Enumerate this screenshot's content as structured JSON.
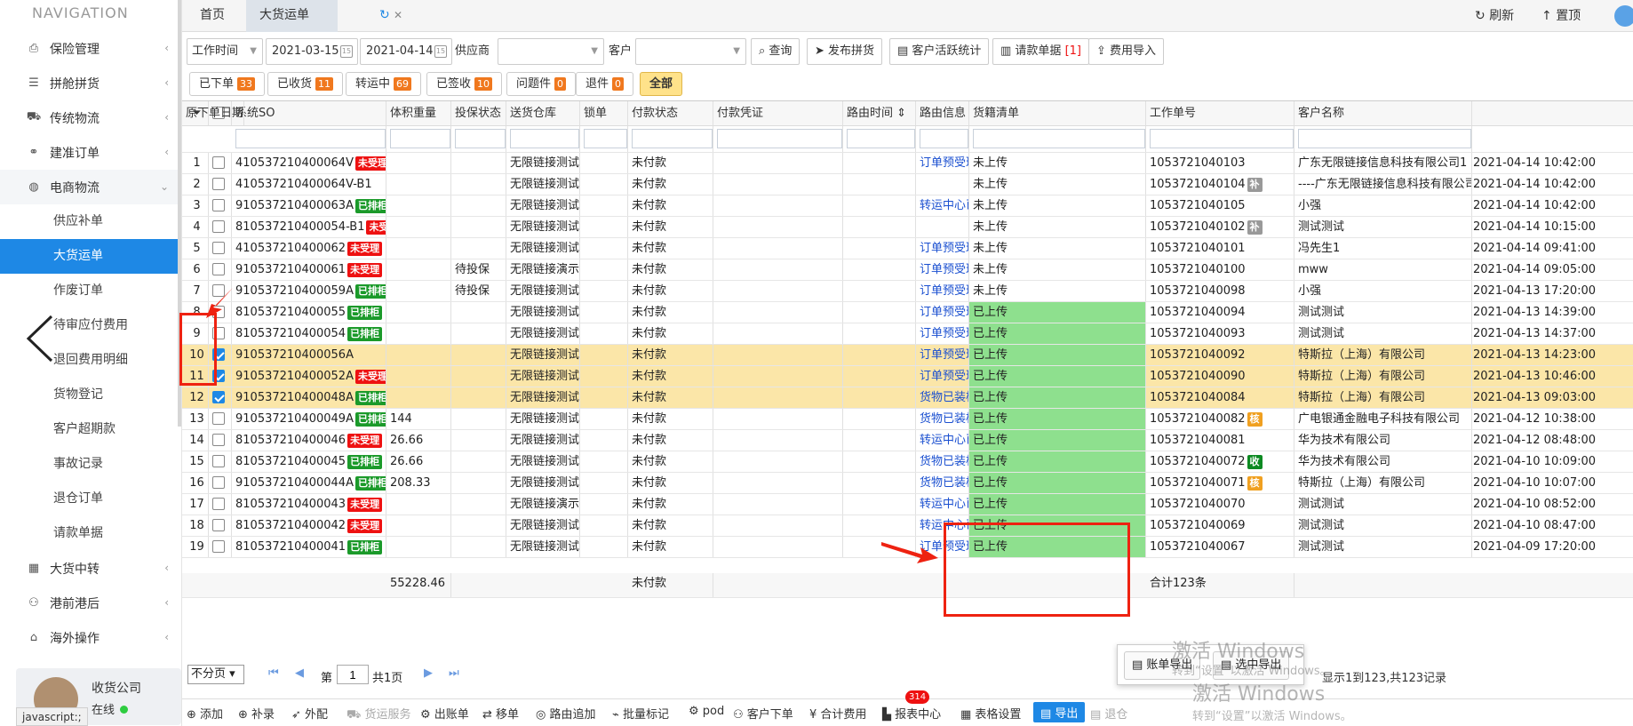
{
  "sidebar": {
    "title": "NAVIGATION",
    "items": [
      {
        "label": "保险管理",
        "icon": "shield-doc-icon"
      },
      {
        "label": "拼舱拼货",
        "icon": "list-icon"
      },
      {
        "label": "传统物流",
        "icon": "truck-icon"
      },
      {
        "label": "建准订单",
        "icon": "link-icon"
      }
    ],
    "open_group": {
      "label": "电商物流",
      "icon": "globe-icon"
    },
    "sub_items": [
      "供应补单",
      "大货运单",
      "作废订单",
      "待审应付费用",
      "退回费用明细",
      "货物登记",
      "客户超期款",
      "事故记录",
      "退仓订单",
      "请款单据"
    ],
    "active_sub": "大货运单",
    "more_items": [
      {
        "label": "大货中转",
        "icon": "grid-icon"
      },
      {
        "label": "港前港后",
        "icon": "people-icon"
      },
      {
        "label": "海外操作",
        "icon": "building-icon"
      }
    ],
    "user": {
      "name": "收货公司",
      "status": "在线"
    },
    "status_url": "javascript:;"
  },
  "tabs": {
    "home": "首页",
    "current": "大货运单"
  },
  "top_actions": {
    "refresh": "刷新",
    "top": "置顶"
  },
  "toolbar": {
    "time_type": "工作时间",
    "date_from": "2021-03-15",
    "date_to": "2021-04-14",
    "supplier_label": "供应商",
    "customer_label": "客户",
    "query": "查询",
    "publish": "发布拼货",
    "stats": "客户活跃统计",
    "payment": "请款单据",
    "payment_count": "[1]",
    "fee_import": "费用导入"
  },
  "filters": [
    {
      "label": "已下单",
      "count": "33"
    },
    {
      "label": "已收货",
      "count": "11"
    },
    {
      "label": "转运中",
      "count": "69"
    },
    {
      "label": "已签收",
      "count": "10"
    },
    {
      "label": "问题件",
      "count": "0"
    },
    {
      "label": "退件",
      "count": "0"
    },
    {
      "label": "全部",
      "count": ""
    }
  ],
  "columns": [
    "系统SO",
    "体积重量",
    "投保状态",
    "送货仓库",
    "锁单",
    "付款状态",
    "付款凭证",
    "路由时间 ⇕",
    "路由信息",
    "货籍清单",
    "工作单号",
    "客户名称",
    "原下单日期"
  ],
  "rows": [
    {
      "no": "1",
      "so": "410537210400064V",
      "tag": "未受理",
      "tagc": "red",
      "vol": "",
      "ins": "",
      "wh": "无限链接测试仓库",
      "pay": "未付款",
      "route": "订单预受理",
      "upl": "未上传",
      "upl_green": false,
      "job": "1053721040103",
      "jt": "",
      "jtc": "",
      "cust": "广东无限链接信息科技有限公司1",
      "date": "2021-04-14 10:42:00",
      "checked": false
    },
    {
      "no": "2",
      "so": "410537210400064V-B1",
      "tag": "",
      "tagc": "",
      "vol": "",
      "ins": "",
      "wh": "无限链接测试仓库",
      "pay": "未付款",
      "route": "",
      "upl": "未上传",
      "upl_green": false,
      "job": "1053721040104",
      "jt": "补",
      "jtc": "gray",
      "cust": "----广东无限链接信息科技有限公司",
      "date": "2021-04-14 10:42:00",
      "checked": false
    },
    {
      "no": "3",
      "so": "910537210400063A",
      "tag": "已排柜",
      "tagc": "green",
      "vol": "",
      "ins": "",
      "wh": "无限链接测试仓库",
      "pay": "未付款",
      "route": "转运中心已收货",
      "upl": "未上传",
      "upl_green": false,
      "job": "1053721040105",
      "jt": "",
      "jtc": "",
      "cust": "小强",
      "date": "2021-04-14 10:42:00",
      "checked": false
    },
    {
      "no": "4",
      "so": "810537210400054-B1",
      "tag": "未受",
      "tagc": "red",
      "vol": "",
      "ins": "",
      "wh": "无限链接测试仓库",
      "pay": "未付款",
      "route": "",
      "upl": "未上传",
      "upl_green": false,
      "job": "1053721040102",
      "jt": "补",
      "jtc": "gray",
      "cust": "测试测试",
      "date": "2021-04-14 10:15:00",
      "checked": false
    },
    {
      "no": "5",
      "so": "410537210400062",
      "tag": "未受理",
      "tagc": "red",
      "vol": "",
      "ins": "",
      "wh": "无限链接测试仓库",
      "pay": "未付款",
      "route": "订单预受理",
      "upl": "未上传",
      "upl_green": false,
      "job": "1053721040101",
      "jt": "",
      "jtc": "",
      "cust": "冯先生1",
      "date": "2021-04-14 09:41:00",
      "checked": false
    },
    {
      "no": "6",
      "so": "910537210400061",
      "tag": "未受理",
      "tagc": "red",
      "vol": "",
      "ins": "待投保",
      "wh": "无限链接演示仓库",
      "pay": "未付款",
      "route": "订单预受理",
      "upl": "未上传",
      "upl_green": false,
      "job": "1053721040100",
      "jt": "",
      "jtc": "",
      "cust": "mww",
      "date": "2021-04-14 09:05:00",
      "checked": false
    },
    {
      "no": "7",
      "so": "910537210400059A",
      "tag": "已排柜",
      "tagc": "green",
      "vol": "",
      "ins": "待投保",
      "wh": "无限链接测试仓库",
      "pay": "未付款",
      "route": "订单预受理Ne",
      "upl": "未上传",
      "upl_green": false,
      "job": "1053721040098",
      "jt": "",
      "jtc": "",
      "cust": "小强",
      "date": "2021-04-13 17:20:00",
      "checked": false
    },
    {
      "no": "8",
      "so": "810537210400055",
      "tag": "已排柜",
      "tagc": "green",
      "vol": "",
      "ins": "",
      "wh": "无限链接测试仓库",
      "pay": "未付款",
      "route": "订单预受理 SC",
      "upl": "已上传",
      "upl_green": true,
      "job": "1053721040094",
      "jt": "",
      "jtc": "",
      "cust": "测试测试",
      "date": "2021-04-13 14:39:00",
      "checked": false
    },
    {
      "no": "9",
      "so": "810537210400054",
      "tag": "已排柜",
      "tagc": "green",
      "vol": "",
      "ins": "",
      "wh": "无限链接测试仓库",
      "pay": "未付款",
      "route": "订单预受理 SC",
      "upl": "已上传",
      "upl_green": true,
      "job": "1053721040093",
      "jt": "",
      "jtc": "",
      "cust": "测试测试",
      "date": "2021-04-13 14:37:00",
      "checked": false
    },
    {
      "no": "10",
      "so": "910537210400056A",
      "tag": "",
      "tagc": "",
      "vol": "",
      "ins": "",
      "wh": "无限链接测试仓库",
      "pay": "未付款",
      "route": "订单预受理",
      "upl": "已上传",
      "upl_green": true,
      "job": "1053721040092",
      "jt": "",
      "jtc": "",
      "cust": "特斯拉（上海）有限公司",
      "date": "2021-04-13 14:23:00",
      "checked": true
    },
    {
      "no": "11",
      "so": "910537210400052A",
      "tag": "未受理",
      "tagc": "red",
      "vol": "",
      "ins": "",
      "wh": "无限链接测试仓库",
      "pay": "未付款",
      "route": "订单预受理",
      "upl": "已上传",
      "upl_green": true,
      "job": "1053721040090",
      "jt": "",
      "jtc": "",
      "cust": "特斯拉（上海）有限公司",
      "date": "2021-04-13 10:46:00",
      "checked": true
    },
    {
      "no": "12",
      "so": "910537210400048A",
      "tag": "已排柜",
      "tagc": "green",
      "vol": "",
      "ins": "",
      "wh": "无限链接测试仓库",
      "pay": "未付款",
      "route": "货物已装柜",
      "upl": "已上传",
      "upl_green": true,
      "job": "1053721040084",
      "jt": "",
      "jtc": "",
      "cust": "特斯拉（上海）有限公司",
      "date": "2021-04-13 09:03:00",
      "checked": true
    },
    {
      "no": "13",
      "so": "910537210400049A",
      "tag": "已排柜",
      "tagc": "green",
      "vol": "144",
      "ins": "",
      "wh": "无限链接测试仓库",
      "pay": "未付款",
      "route": "货物已装柜",
      "upl": "已上传",
      "upl_green": true,
      "job": "1053721040082",
      "jt": "核",
      "jtc": "orange",
      "cust": "广电银通金融电子科技有限公司",
      "date": "2021-04-12 10:38:00",
      "checked": false
    },
    {
      "no": "14",
      "so": "810537210400046",
      "tag": "未受理",
      "tagc": "red",
      "vol": "26.66",
      "ins": "",
      "wh": "无限链接测试仓库",
      "pay": "未付款",
      "route": "转运中心已收货",
      "upl": "已上传",
      "upl_green": true,
      "job": "1053721040081",
      "jt": "",
      "jtc": "",
      "cust": "华为技术有限公司",
      "date": "2021-04-12 08:48:00",
      "checked": false
    },
    {
      "no": "15",
      "so": "810537210400045",
      "tag": "已排柜",
      "tagc": "green",
      "vol": "26.66",
      "ins": "",
      "wh": "无限链接测试仓库",
      "pay": "未付款",
      "route": "货物已装柜",
      "upl": "已上传",
      "upl_green": true,
      "job": "1053721040072",
      "jt": "收",
      "jtc": "dgreen",
      "cust": "华为技术有限公司",
      "date": "2021-04-10 10:09:00",
      "checked": false
    },
    {
      "no": "16",
      "so": "910537210400044A",
      "tag": "已排柜",
      "tagc": "green",
      "vol": "208.33",
      "ins": "",
      "wh": "无限链接测试仓库",
      "pay": "未付款",
      "route": "货物已装柜",
      "upl": "已上传",
      "upl_green": true,
      "job": "1053721040071",
      "jt": "核",
      "jtc": "orange",
      "cust": "特斯拉（上海）有限公司",
      "date": "2021-04-10 10:07:00",
      "checked": false
    },
    {
      "no": "17",
      "so": "810537210400043",
      "tag": "未受理",
      "tagc": "red",
      "vol": "",
      "ins": "",
      "wh": "无限链接演示仓库",
      "pay": "未付款",
      "route": "转运中心已收货",
      "upl": "已上传",
      "upl_green": true,
      "job": "1053721040070",
      "jt": "",
      "jtc": "",
      "cust": "测试测试",
      "date": "2021-04-10 08:52:00",
      "checked": false
    },
    {
      "no": "18",
      "so": "810537210400042",
      "tag": "未受理",
      "tagc": "red",
      "vol": "",
      "ins": "",
      "wh": "无限链接测试仓库",
      "pay": "未付款",
      "route": "转运中心已收货",
      "upl": "已上传",
      "upl_green": true,
      "job": "1053721040069",
      "jt": "",
      "jtc": "",
      "cust": "测试测试",
      "date": "2021-04-10 08:47:00",
      "checked": false
    },
    {
      "no": "19",
      "so": "810537210400041",
      "tag": "已排柜",
      "tagc": "green",
      "vol": "",
      "ins": "",
      "wh": "无限链接测试仓库",
      "pay": "未付款",
      "route": "订单预受理 SC",
      "upl": "已上传",
      "upl_green": true,
      "job": "1053721040067",
      "jt": "",
      "jtc": "",
      "cust": "测试测试",
      "date": "2021-04-09 17:20:00",
      "checked": false
    }
  ],
  "footer": {
    "volume_total": "55228.46",
    "pay": "未付款",
    "count": "合计123条"
  },
  "pager": {
    "mode": "不分页",
    "page_prefix": "第",
    "page": "1",
    "page_suffix": "共1页",
    "summary": "显示1到123,共123记录"
  },
  "bottom": {
    "add": "添加",
    "supplement": "补录",
    "outsource": "外配",
    "warehouse_service": "货运服务",
    "bill": "出账单",
    "move": "移单",
    "route_add": "路由追加",
    "batch_mark": "批量标记",
    "pod": "pod",
    "customer_order": "客户下单",
    "customer_order_badge": "314",
    "total_fee": "合计费用",
    "report": "报表中心",
    "grid_settings": "表格设置",
    "export": "导出",
    "return": "退仓"
  },
  "export_popup": {
    "bill_export": "账单导出",
    "selected_export": "选中导出"
  },
  "watermark": {
    "line1": "激活 Windows",
    "line2": "转到“设置”以激活 Windows。"
  },
  "colors": {
    "accent": "#1e88e5",
    "selected_row": "#fbe6a8",
    "uploaded": "#8ee08e",
    "annotation": "#e21"
  }
}
